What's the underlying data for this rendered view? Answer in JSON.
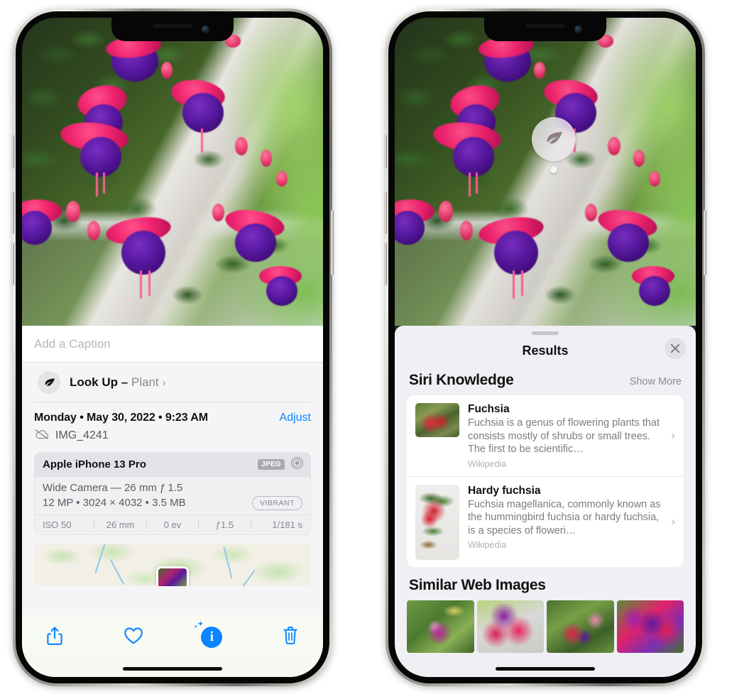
{
  "left_phone": {
    "photo": {
      "alt_name": "fuchsia-flowers-photo"
    },
    "caption_field": {
      "placeholder": "Add a Caption",
      "value": ""
    },
    "look_up": {
      "icon": "leaf-icon",
      "sparkle_icon": "sparkles-icon",
      "label": "Look Up – ",
      "subject": "Plant",
      "chevron": "›"
    },
    "datetime": {
      "text": "Monday • May 30, 2022 • 9:23 AM",
      "adjust_label": "Adjust"
    },
    "file": {
      "icon": "icloud-slash-icon",
      "name": "IMG_4241"
    },
    "camera_card": {
      "model": "Apple iPhone 13 Pro",
      "format_badge": "JPEG",
      "aperture_icon": "aperture-icon",
      "lens_line": "Wide Camera — 26 mm ƒ 1.5",
      "specs_line": "12 MP • 3024 × 4032 • 3.5 MB",
      "vibrant_badge": "VIBRANT",
      "exif": [
        "ISO 50",
        "26 mm",
        "0 ev",
        "ƒ1.5",
        "1/181 s"
      ]
    },
    "map": {
      "name": "location-map",
      "pin": "photo-pin-thumbnail"
    },
    "toolbar": [
      {
        "name": "share-button",
        "icon": "share-icon",
        "active": false
      },
      {
        "name": "favorite-button",
        "icon": "heart-icon",
        "active": false
      },
      {
        "name": "info-button",
        "icon": "info-sparkle-icon",
        "active": true,
        "glyph": "i"
      },
      {
        "name": "delete-button",
        "icon": "trash-icon",
        "active": false
      }
    ]
  },
  "right_phone": {
    "visual_look_up_badge": {
      "icon": "leaf-icon",
      "name": "visual-look-up-badge"
    },
    "sheet": {
      "grabber": "sheet-grabber",
      "title": "Results",
      "close_icon": "close-icon",
      "sections": [
        {
          "name": "siri-knowledge",
          "title": "Siri Knowledge",
          "action_label": "Show More",
          "items": [
            {
              "title": "Fuchsia",
              "description": "Fuchsia is a genus of flowering plants that consists mostly of shrubs or small trees. The first to be scientific…",
              "source": "Wikipedia",
              "thumb": "fuchsia-thumbnail",
              "chevron": "›"
            },
            {
              "title": "Hardy fuchsia",
              "description": "Fuchsia magellanica, commonly known as the hummingbird fuchsia or hardy fuchsia, is a species of floweri…",
              "source": "Wikipedia",
              "thumb": "hardy-fuchsia-thumbnail",
              "chevron": "›"
            }
          ]
        },
        {
          "name": "similar-web-images",
          "title": "Similar Web Images",
          "images": [
            {
              "name": "web-image-1"
            },
            {
              "name": "web-image-2"
            },
            {
              "name": "web-image-3"
            },
            {
              "name": "web-image-4"
            }
          ]
        }
      ]
    }
  },
  "colors": {
    "accent_blue": "#0a84ff",
    "sheet_bg": "#f0eff4",
    "panel_bg": "#f5f5f7",
    "card_bg": "#ffffff"
  }
}
